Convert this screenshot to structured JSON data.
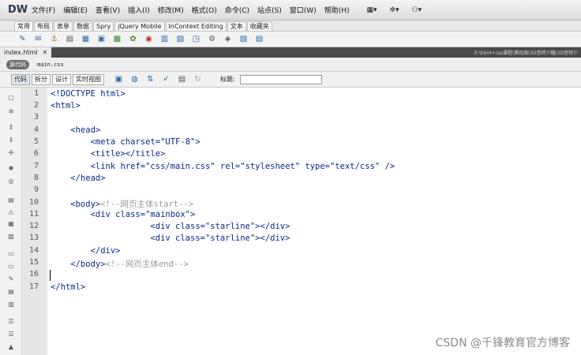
{
  "app": {
    "logo": "DW",
    "menu": [
      "文件(F)",
      "编辑(E)",
      "查看(V)",
      "插入(I)",
      "修改(M)",
      "格式(O)",
      "命令(C)",
      "站点(S)",
      "窗口(W)",
      "帮助(H)"
    ]
  },
  "insert_panel": {
    "tabs": [
      "常用",
      "布局",
      "表单",
      "数据",
      "Spry",
      "jQuery Mobile",
      "InContext Editing",
      "文本",
      "收藏夹"
    ],
    "active_tab": "常用"
  },
  "document": {
    "tab_label": "index.html",
    "path": "E:\\html+css课程\\第四周\\3D音特少幅\\3D音特少",
    "source_pill": "源代码",
    "related_file": "main.css"
  },
  "doc_toolbar": {
    "views": [
      "代码",
      "拆分",
      "设计",
      "实时视图"
    ],
    "active_view": "代码",
    "title_label": "标题:",
    "title_value": ""
  },
  "editor": {
    "line_numbers": [
      "1",
      "2",
      "3",
      "4",
      "5",
      "6",
      "7",
      "8",
      "9",
      "10",
      "11",
      "12",
      "13",
      "14",
      "15",
      "16",
      "17"
    ],
    "lines": [
      "<!DOCTYPE html>",
      "<html>",
      "",
      "    <head>",
      "        <meta charset=\"UTF-8\">",
      "        <title></title>",
      "        <link href=\"css/main.css\" rel=\"stylesheet\" type=\"text/css\" />",
      "    </head>",
      "",
      "    <body>",
      "        <div class=\"mainbox\">",
      "                    <div class=\"starline\"></div>",
      "                    <div class=\"starline\"></div>",
      "        </div>",
      "    </body>",
      "",
      "</html>"
    ],
    "comments": {
      "line10": "<!--网页主体start-->",
      "line15": "<!--网页主体end-->"
    },
    "caret_line": 16
  },
  "watermark": "CSDN @千锋教育官方博客"
}
